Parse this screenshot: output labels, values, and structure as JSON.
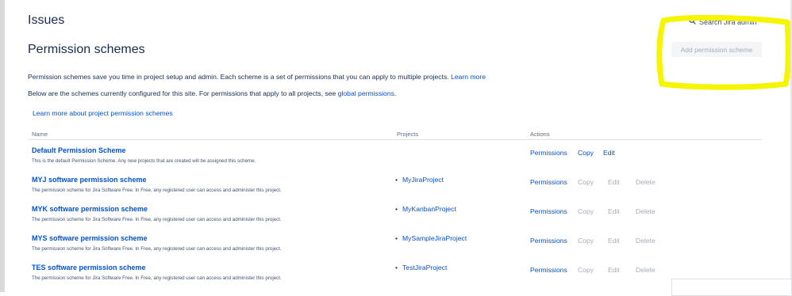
{
  "header": {
    "section_title": "Issues",
    "search_label": "Search Jira admin"
  },
  "page": {
    "title": "Permission schemes",
    "add_button": "Add permission scheme",
    "desc1_text": "Permission schemes save you time in project setup and admin. Each scheme is a set of permissions that you can apply to multiple projects.",
    "desc1_link": "Learn more",
    "desc2_text": "Below are the schemes currently configured for this site. For permissions that apply to all projects, see",
    "desc2_link": "global permissions",
    "desc2_end": ".",
    "learn_more_link": "Learn more about project permission schemes"
  },
  "table": {
    "headers": {
      "name": "Name",
      "projects": "Projects",
      "actions": "Actions"
    },
    "rows": [
      {
        "name": "Default Permission Scheme",
        "description": "This is the default Permission Scheme. Any new projects that are created will be assigned this scheme.",
        "project": "",
        "actions": {
          "permissions": "Permissions",
          "copy": "Copy",
          "edit": "Edit",
          "delete": ""
        }
      },
      {
        "name": "MYJ software permission scheme",
        "description": "The permission scheme for Jira Software Free. In Free, any registered user can access and administer this project.",
        "project": "MyJiraProject",
        "actions": {
          "permissions": "Permissions",
          "copy": "Copy",
          "edit": "Edit",
          "delete": "Delete"
        }
      },
      {
        "name": "MYK software permission scheme",
        "description": "The permission scheme for Jira Software Free. In Free, any registered user can access and administer this project.",
        "project": "MyKanbanProject",
        "actions": {
          "permissions": "Permissions",
          "copy": "Copy",
          "edit": "Edit",
          "delete": "Delete"
        }
      },
      {
        "name": "MYS software permission scheme",
        "description": "The permission scheme for Jira Software Free. In Free, any registered user can access and administer this project.",
        "project": "MySampleJiraProject",
        "actions": {
          "permissions": "Permissions",
          "copy": "Copy",
          "edit": "Edit",
          "delete": "Delete"
        }
      },
      {
        "name": "TES software permission scheme",
        "description": "The permission scheme for Jira Software Free. In Free, any registered user can access and administer this project.",
        "project": "TestJiraProject",
        "actions": {
          "permissions": "Permissions",
          "copy": "Copy",
          "edit": "Edit",
          "delete": "Delete"
        }
      }
    ]
  },
  "colors": {
    "link": "#0052cc",
    "text": "#172b4d",
    "disabled": "#a5adba",
    "highlight": "#f5f500"
  },
  "icons": {
    "search": "search-icon"
  }
}
